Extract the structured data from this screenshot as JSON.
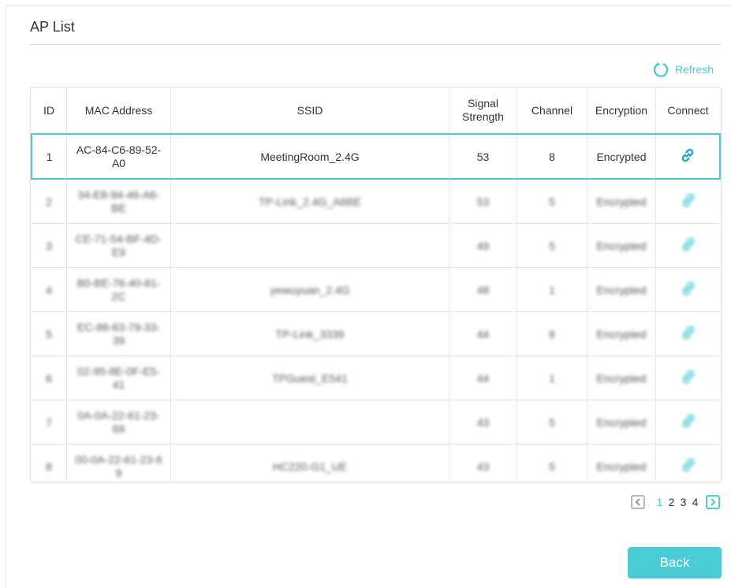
{
  "title": "AP List",
  "refresh_label": "Refresh",
  "accent_color": "#4acbd6",
  "table": {
    "headers": {
      "id": "ID",
      "mac": "MAC Address",
      "ssid": "SSID",
      "signal_line1": "Signal",
      "signal_line2": "Strength",
      "channel": "Channel",
      "encryption": "Encryption",
      "connect": "Connect"
    },
    "rows": [
      {
        "id": "1",
        "mac": "AC-84-C6-89-52-A0",
        "ssid": "MeetingRoom_2.4G",
        "signal": "53",
        "channel": "8",
        "encryption": "Encrypted",
        "selected": true
      },
      {
        "id": "2",
        "mac": "34-E8-94-46-A6-BE",
        "ssid": "TP-Link_2.4G_A6BE",
        "signal": "53",
        "channel": "5",
        "encryption": "Encrypted"
      },
      {
        "id": "3",
        "mac": "CE-71-54-BF-4D-E9",
        "ssid": "",
        "signal": "49",
        "channel": "5",
        "encryption": "Encrypted"
      },
      {
        "id": "4",
        "mac": "B0-BE-76-40-81-2C",
        "ssid": "yewuyuan_2.4G",
        "signal": "48",
        "channel": "1",
        "encryption": "Encrypted"
      },
      {
        "id": "5",
        "mac": "EC-88-63-79-33-39",
        "ssid": "TP-Link_3339",
        "signal": "44",
        "channel": "8",
        "encryption": "Encrypted"
      },
      {
        "id": "6",
        "mac": "02-95-8E-0F-E5-41",
        "ssid": "TPGuest_E541",
        "signal": "44",
        "channel": "1",
        "encryption": "Encrypted"
      },
      {
        "id": "7",
        "mac": "0A-0A-22-61-23-69",
        "ssid": "",
        "signal": "43",
        "channel": "5",
        "encryption": "Encrypted"
      },
      {
        "id": "8",
        "mac": "00-0A-22-61-23-69",
        "ssid": "HC220-G1_UE",
        "signal": "43",
        "channel": "5",
        "encryption": "Encrypted"
      }
    ]
  },
  "pagination": {
    "pages": [
      "1",
      "2",
      "3",
      "4"
    ],
    "current": "1"
  },
  "back_label": "Back"
}
